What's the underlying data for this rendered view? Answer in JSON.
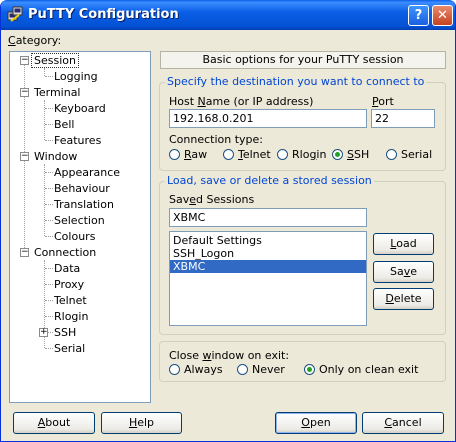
{
  "window": {
    "title": "PuTTY Configuration",
    "help_button": "?",
    "close_button": "✕"
  },
  "category_label": "Category:",
  "tree": {
    "items": [
      {
        "label": "Session",
        "level": 1,
        "expander": "−",
        "selected": true
      },
      {
        "label": "Logging",
        "level": 2
      },
      {
        "label": "Terminal",
        "level": 1,
        "expander": "−"
      },
      {
        "label": "Keyboard",
        "level": 2
      },
      {
        "label": "Bell",
        "level": 2
      },
      {
        "label": "Features",
        "level": 2
      },
      {
        "label": "Window",
        "level": 1,
        "expander": "−"
      },
      {
        "label": "Appearance",
        "level": 2
      },
      {
        "label": "Behaviour",
        "level": 2
      },
      {
        "label": "Translation",
        "level": 2
      },
      {
        "label": "Selection",
        "level": 2
      },
      {
        "label": "Colours",
        "level": 2
      },
      {
        "label": "Connection",
        "level": 1,
        "expander": "−"
      },
      {
        "label": "Data",
        "level": 2
      },
      {
        "label": "Proxy",
        "level": 2
      },
      {
        "label": "Telnet",
        "level": 2
      },
      {
        "label": "Rlogin",
        "level": 2
      },
      {
        "label": "SSH",
        "level": 2,
        "expander": "+"
      },
      {
        "label": "Serial",
        "level": 2
      }
    ]
  },
  "panel_header": "Basic options for your PuTTY session",
  "destination": {
    "title": "Specify the destination you want to connect to",
    "host_label": "Host Name (or IP address)",
    "host_value": "192.168.0.201",
    "port_label": "Port",
    "port_value": "22",
    "conn_type_label": "Connection type:",
    "conn_types": [
      "Raw",
      "Telnet",
      "Rlogin",
      "SSH",
      "Serial"
    ],
    "selected": "SSH"
  },
  "sessions": {
    "title": "Load, save or delete a stored session",
    "saved_label": "Saved Sessions",
    "saved_value": "XBMC",
    "list": [
      "Default Settings",
      "SSH_Logon",
      "XBMC"
    ],
    "selected": "XBMC",
    "load": "Load",
    "save": "Save",
    "delete": "Delete"
  },
  "close_on_exit": {
    "label": "Close window on exit:",
    "options": [
      "Always",
      "Never",
      "Only on clean exit"
    ],
    "selected": "Only on clean exit"
  },
  "footer": {
    "about": "About",
    "help": "Help",
    "open": "Open",
    "cancel": "Cancel"
  }
}
